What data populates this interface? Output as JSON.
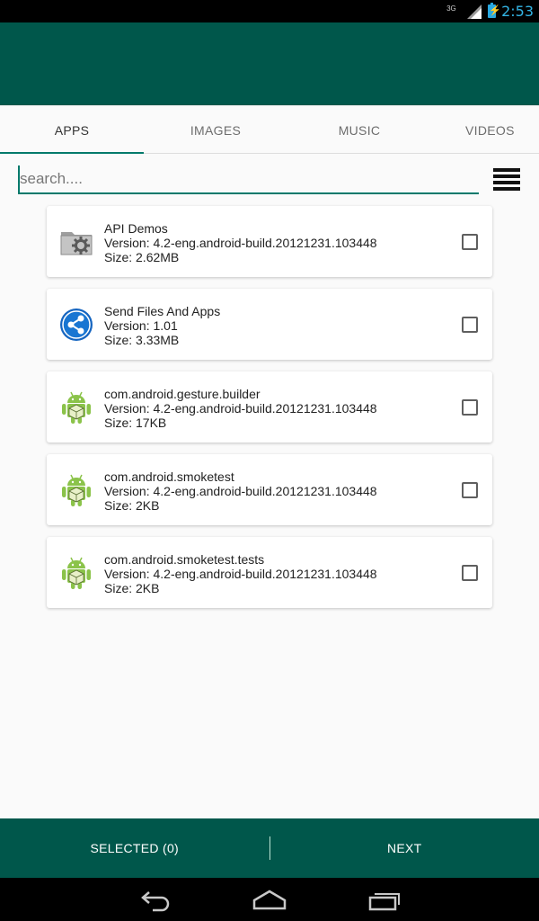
{
  "status_bar": {
    "network": "3G",
    "time": "2:53"
  },
  "tabs": [
    {
      "label": "APPS",
      "active": true
    },
    {
      "label": "IMAGES",
      "active": false
    },
    {
      "label": "MUSIC",
      "active": false
    },
    {
      "label": "VIDEOS",
      "active": false
    }
  ],
  "search": {
    "placeholder": "search....",
    "value": ""
  },
  "menu_icon": "list-icon",
  "apps": [
    {
      "name": "API Demos",
      "version": "Version: 4.2-eng.android-build.20121231.103448",
      "size": "Size: 2.62MB",
      "icon": "settings-folder-icon",
      "checked": false
    },
    {
      "name": "Send Files And Apps",
      "version": "Version: 1.01",
      "size": "Size: 3.33MB",
      "icon": "share-icon",
      "checked": false
    },
    {
      "name": "com.android.gesture.builder",
      "version": "Version: 4.2-eng.android-build.20121231.103448",
      "size": "Size: 17KB",
      "icon": "android-robot-icon",
      "checked": false
    },
    {
      "name": "com.android.smoketest",
      "version": "Version: 4.2-eng.android-build.20121231.103448",
      "size": "Size: 2KB",
      "icon": "android-robot-icon",
      "checked": false
    },
    {
      "name": "com.android.smoketest.tests",
      "version": "Version: 4.2-eng.android-build.20121231.103448",
      "size": "Size: 2KB",
      "icon": "android-robot-icon",
      "checked": false
    }
  ],
  "bottom_bar": {
    "selected_label": "SELECTED (0)",
    "next_label": "NEXT"
  },
  "colors": {
    "primary": "#00574b",
    "accent": "#00796b",
    "clock": "#33b5e5"
  }
}
